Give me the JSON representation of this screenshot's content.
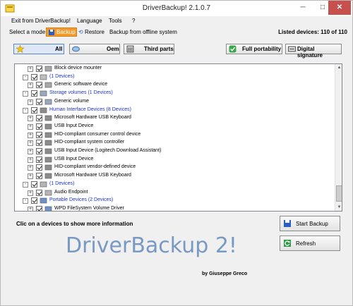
{
  "window": {
    "title": "DriverBackup! 2.1.0.7",
    "min": "─",
    "max": "□",
    "close": "✕"
  },
  "menu": {
    "items": [
      "Exit from DriverBackup!",
      "Language",
      "Tools",
      "?"
    ]
  },
  "modes": {
    "label": "Select a mode",
    "backup": "Backup",
    "restore": "Restore",
    "offline": "Backup from offline system",
    "listed": "Listed devices: 110 of 110"
  },
  "filters": {
    "all": "All",
    "oem": "Oem",
    "third": "Third parts",
    "full_portability": "Full portability",
    "digital_signature": "Digital signature"
  },
  "tree": {
    "rows": [
      {
        "level": 1,
        "expander": "+",
        "label": "Block device mounter",
        "category": false,
        "icon": "device-icon"
      },
      {
        "level": 0,
        "expander": "-",
        "label": "(1 Devices)",
        "category": true,
        "icon": "category-icon"
      },
      {
        "level": 1,
        "expander": "+",
        "label": "Generic software device",
        "category": false,
        "icon": "device-icon"
      },
      {
        "level": 0,
        "expander": "-",
        "label": "Storage volumes  (1 Devices)",
        "category": true,
        "icon": "storage-icon"
      },
      {
        "level": 1,
        "expander": "+",
        "label": "Generic volume",
        "category": false,
        "icon": "volume-icon"
      },
      {
        "level": 0,
        "expander": "-",
        "label": "Human Interface Devices  (8 Devices)",
        "category": true,
        "icon": "hid-icon"
      },
      {
        "level": 1,
        "expander": "+",
        "label": "Microsoft Hardware USB Keyboard",
        "category": false,
        "icon": "hid-icon"
      },
      {
        "level": 1,
        "expander": "+",
        "label": "USB Input Device",
        "category": false,
        "icon": "hid-icon"
      },
      {
        "level": 1,
        "expander": "+",
        "label": "HID-compliant consumer control device",
        "category": false,
        "icon": "hid-icon"
      },
      {
        "level": 1,
        "expander": "+",
        "label": "HID-compliant system controller",
        "category": false,
        "icon": "hid-icon"
      },
      {
        "level": 1,
        "expander": "+",
        "label": "USB Input Device (Logitech Download Assistant)",
        "category": false,
        "icon": "hid-icon"
      },
      {
        "level": 1,
        "expander": "+",
        "label": "USB Input Device",
        "category": false,
        "icon": "hid-icon"
      },
      {
        "level": 1,
        "expander": "+",
        "label": "HID-compliant vendor-defined device",
        "category": false,
        "icon": "hid-icon"
      },
      {
        "level": 1,
        "expander": "+",
        "label": "Microsoft Hardware USB Keyboard",
        "category": false,
        "icon": "hid-icon"
      },
      {
        "level": 0,
        "expander": "-",
        "label": "(1 Devices)",
        "category": true,
        "icon": "audio-icon"
      },
      {
        "level": 1,
        "expander": "+",
        "label": "Audio Endpoint",
        "category": false,
        "icon": "audio-icon"
      },
      {
        "level": 0,
        "expander": "-",
        "label": "Portable Devices  (2 Devices)",
        "category": true,
        "icon": "portable-icon"
      },
      {
        "level": 1,
        "expander": "+",
        "label": "WPD FileSystem Volume Driver",
        "category": false,
        "icon": "portable-icon"
      }
    ]
  },
  "footer": {
    "info": "Clic on a devices to show more information",
    "start_backup": "Start Backup",
    "refresh": "Refresh",
    "big_title": "DriverBackup 2!",
    "byline": "by Giuseppe Greco"
  },
  "colors": {
    "accent": "#f39a2a",
    "category": "#1a33d4",
    "title": "#7899c2"
  }
}
